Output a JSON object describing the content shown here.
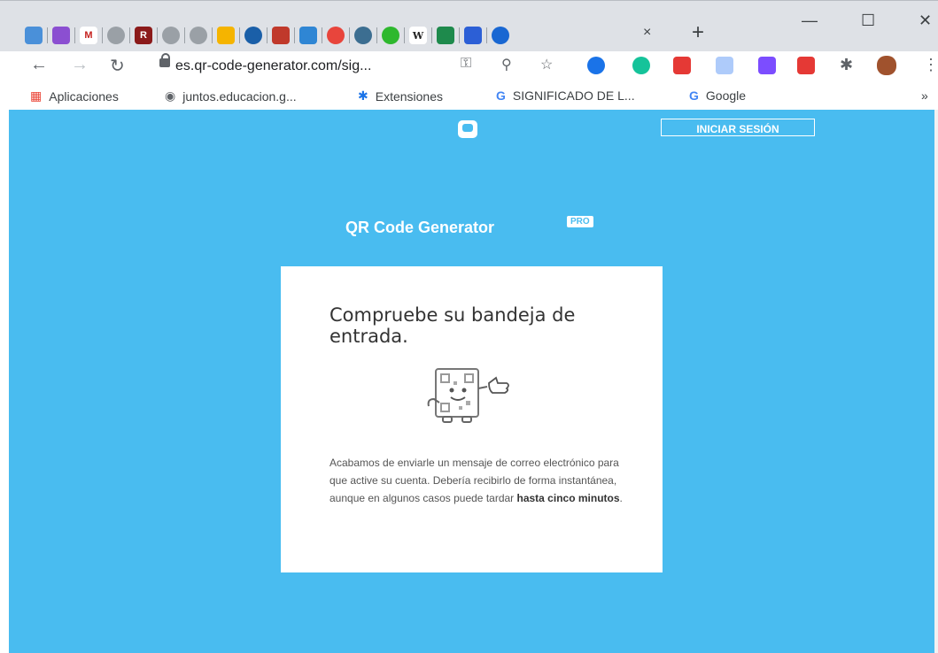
{
  "browser": {
    "new_tab": "+",
    "close_tab": "×",
    "window_controls": {
      "minimize": "—",
      "maximize": "☐",
      "close": "✕"
    },
    "url": "es.qr-code-generator.com/sig...",
    "tab_icon_labels": [
      "M",
      "R",
      "W"
    ],
    "more_bookmarks": "»",
    "bookmarks": [
      {
        "label": "Aplicaciones",
        "icon": "apps-grid-icon"
      },
      {
        "label": "juntos.educacion.g...",
        "icon": "globe-icon"
      },
      {
        "label": "Extensiones",
        "icon": "puzzle-icon"
      },
      {
        "label": "SIGNIFICADO DE L...",
        "icon": "google-icon"
      },
      {
        "label": "Google",
        "icon": "google-icon"
      }
    ]
  },
  "page": {
    "login_button": "INICIAR SESIÓN",
    "app_title": "QR Code Generator",
    "pro_badge": "PRO",
    "card": {
      "heading": "Compruebe su bandeja de entrada.",
      "message_part1": "Acabamos de enviarle un mensaje de correo electrónico para que active su cuenta. Debería recibirlo de forma instantánea, aunque en algunos casos puede tardar ",
      "message_bold": "hasta cinco minutos",
      "message_end": "."
    }
  },
  "colors": {
    "accent": "#49bcf0",
    "chrome": "#dee1e6"
  }
}
